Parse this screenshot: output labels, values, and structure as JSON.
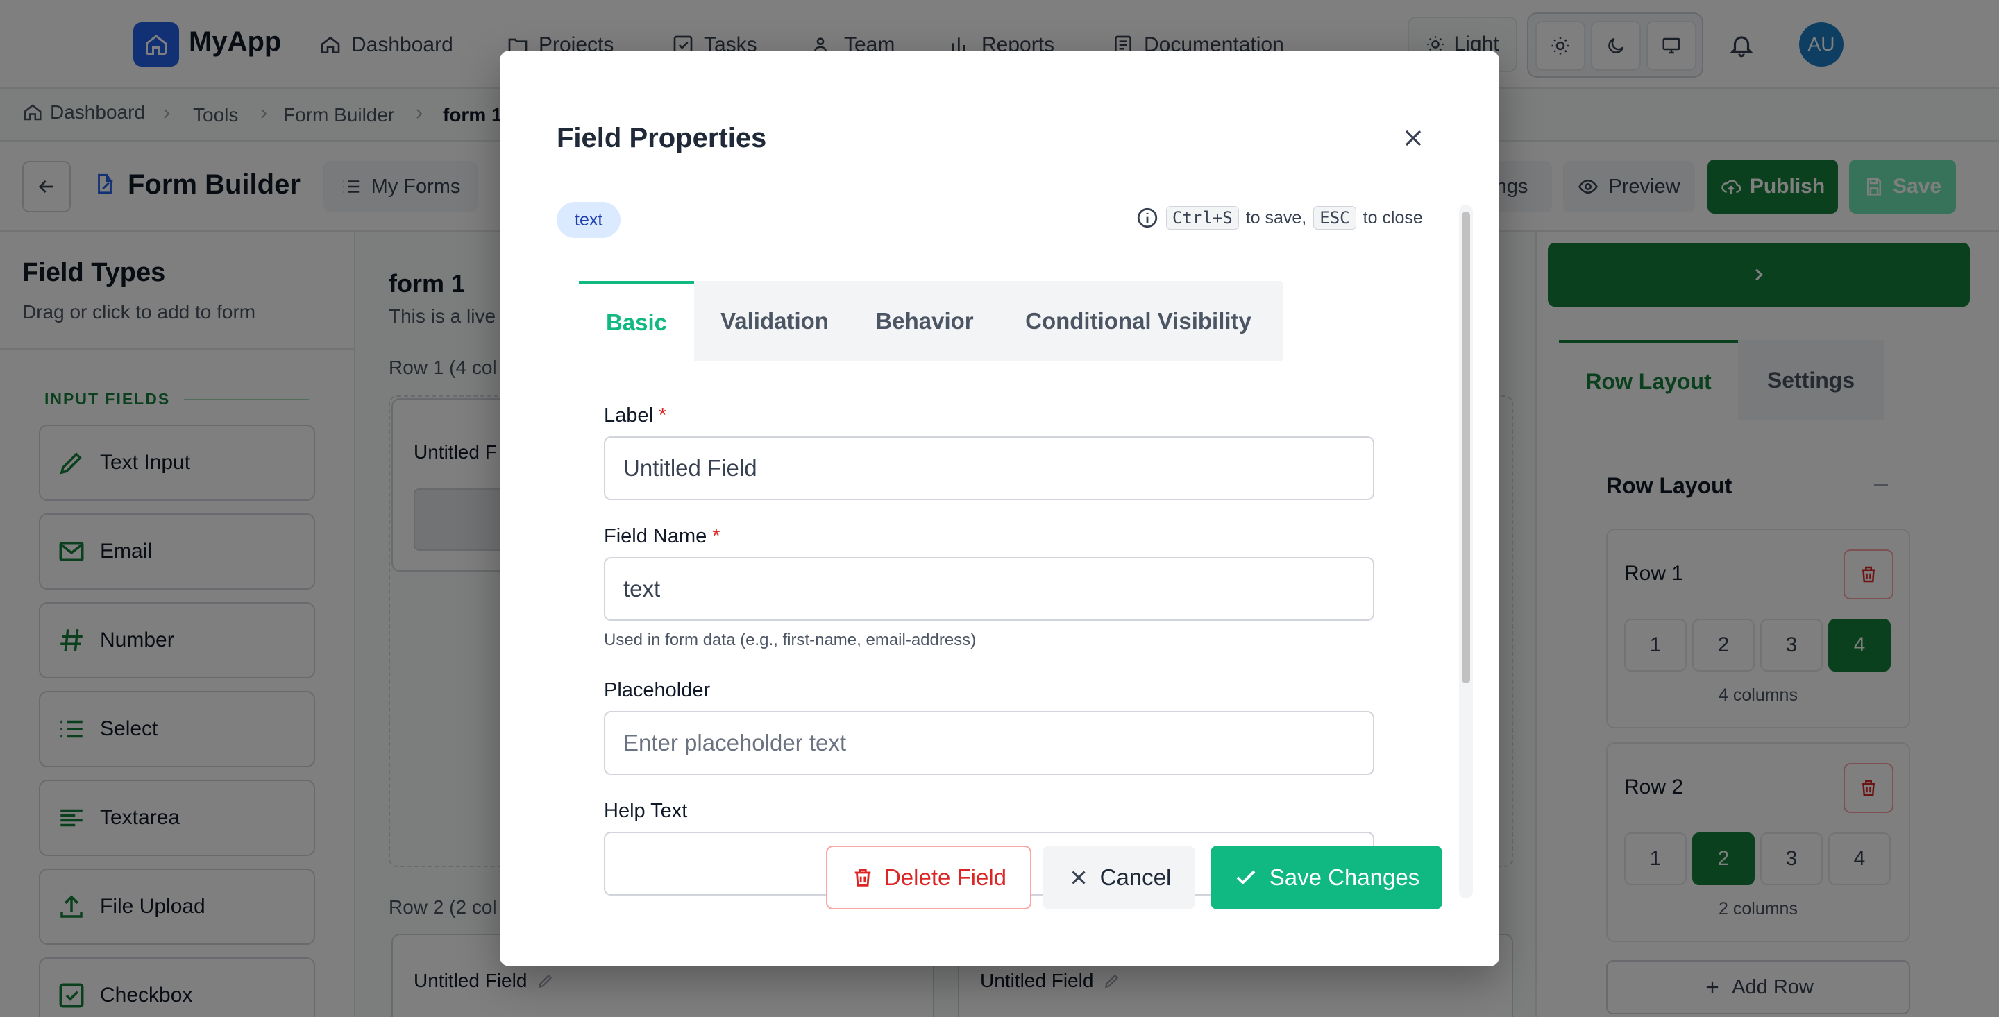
{
  "app": {
    "name": "MyApp"
  },
  "nav": {
    "items": [
      {
        "label": "Dashboard",
        "icon": "home-icon"
      },
      {
        "label": "Projects",
        "icon": "folder-icon"
      },
      {
        "label": "Tasks",
        "icon": "checkbox-icon"
      },
      {
        "label": "Team",
        "icon": "users-icon"
      },
      {
        "label": "Reports",
        "icon": "bar-chart-icon"
      },
      {
        "label": "Documentation",
        "icon": "document-icon"
      }
    ],
    "theme_label": "Light",
    "avatar_initials": "AU"
  },
  "breadcrumb": [
    "Dashboard",
    "Tools",
    "Form Builder",
    "form 1"
  ],
  "toolbar": {
    "title": "Form Builder",
    "my_forms": "My Forms",
    "settings_partial": "ngs",
    "preview": "Preview",
    "publish": "Publish",
    "save": "Save"
  },
  "field_types": {
    "title": "Field Types",
    "subtitle": "Drag or click to add to form",
    "section": "INPUT FIELDS",
    "items": [
      "Text Input",
      "Email",
      "Number",
      "Select",
      "Textarea",
      "File Upload",
      "Checkbox"
    ]
  },
  "canvas": {
    "form_title": "form 1",
    "description_partial": "This is a live",
    "row1_label_partial": "Row 1 (4 col",
    "row2_label_partial": "Row 2 (2 col",
    "field_partial": "Untitled F",
    "field_full": "Untitled Field"
  },
  "right_panel": {
    "tabs": [
      "Row Layout",
      "Settings"
    ],
    "section_title": "Row Layout",
    "rows": [
      {
        "name": "Row 1",
        "options": [
          "1",
          "2",
          "3",
          "4"
        ],
        "selected": "4",
        "caption": "4 columns"
      },
      {
        "name": "Row 2",
        "options": [
          "1",
          "2",
          "3",
          "4"
        ],
        "selected": "2",
        "caption": "2 columns"
      }
    ],
    "add_row": "Add Row"
  },
  "modal": {
    "title": "Field Properties",
    "type_badge": "text",
    "shortcut_key_save": "Ctrl+S",
    "shortcut_text_save": "to save,",
    "shortcut_key_close": "ESC",
    "shortcut_text_close": "to close",
    "tabs": [
      "Basic",
      "Validation",
      "Behavior",
      "Conditional Visibility"
    ],
    "active_tab": "Basic",
    "fields": {
      "label": {
        "label": "Label",
        "required_mark": "*",
        "value": "Untitled Field"
      },
      "name": {
        "label": "Field Name",
        "required_mark": "*",
        "value": "text",
        "help": "Used in form data (e.g., first-name, email-address)"
      },
      "placeholder": {
        "label": "Placeholder",
        "placeholder": "Enter placeholder text"
      },
      "help_text": {
        "label": "Help Text"
      }
    },
    "buttons": {
      "delete": "Delete Field",
      "cancel": "Cancel",
      "save": "Save Changes"
    }
  },
  "colors": {
    "brand": "#2563eb",
    "green": "#15803d",
    "accent": "#10b981",
    "danger": "#dc2626"
  }
}
